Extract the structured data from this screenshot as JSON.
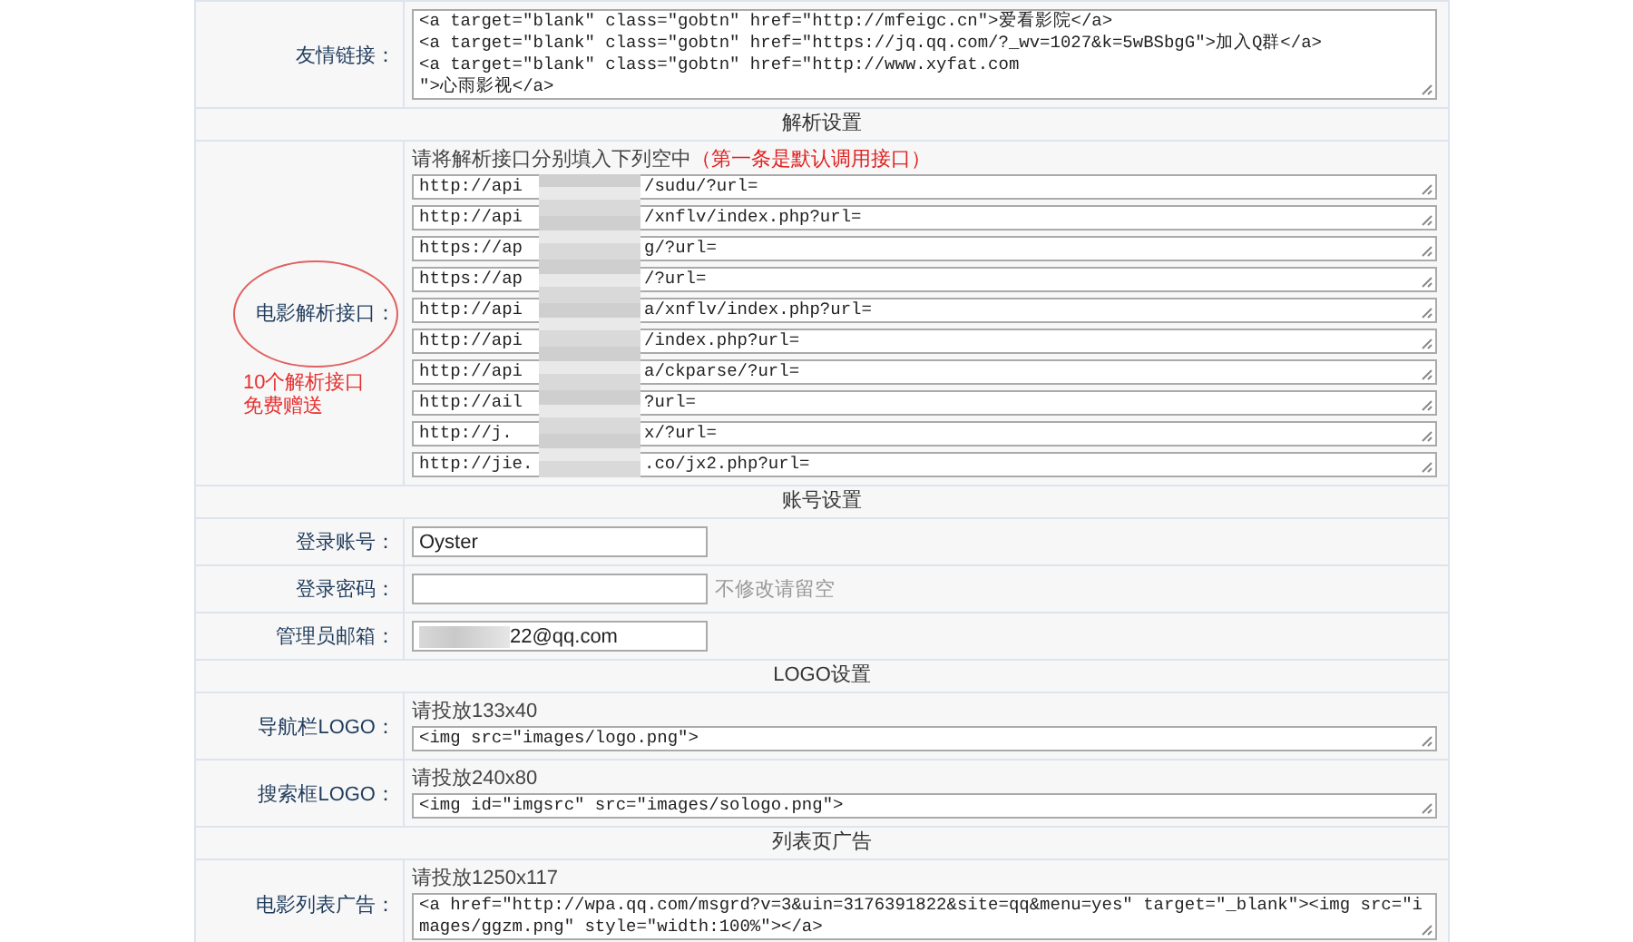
{
  "sections": [
    {
      "kind": "row",
      "label": "友情链接：",
      "code": "<a target=\"blank\" class=\"gobtn\" href=\"http://mfeigc.cn\">爱看影院</a>\n<a target=\"blank\" class=\"gobtn\" href=\"https://jq.qq.com/?_wv=1027&k=5wBSbgG\">加入Q群</a>\n<a target=\"blank\" class=\"gobtn\" href=\"http://www.xyfat.com\n\">心雨影视</a>"
    },
    {
      "kind": "header",
      "title": "解析设置"
    },
    {
      "kind": "apis",
      "label": "电影解析接口：",
      "circled": true,
      "annotation": "10个解析接口免费赠送",
      "hint": "请将解析接口分别填入下列空中",
      "hint_note": "（第一条是默认调用接口）",
      "redacted": true,
      "fields": [
        {
          "start": "http://api",
          "end": "/sudu/?url="
        },
        {
          "start": "http://api",
          "end": "/xnflv/index.php?url="
        },
        {
          "start": "https://ap",
          "end": "g/?url="
        },
        {
          "start": "https://ap",
          "end": "/?url="
        },
        {
          "start": "http://api",
          "end": "a/xnflv/index.php?url="
        },
        {
          "start": "http://api",
          "end": "/index.php?url="
        },
        {
          "start": "http://api",
          "end": "a/ckparse/?url="
        },
        {
          "start": "http://ail",
          "end": "?url="
        },
        {
          "start": "http://j.",
          "end": "x/?url="
        },
        {
          "start": "http://jie.",
          "end": ".co/jx2.php?url="
        }
      ]
    },
    {
      "kind": "header",
      "title": "账号设置"
    },
    {
      "kind": "input",
      "label": "登录账号：",
      "value": "Oyster"
    },
    {
      "kind": "input",
      "label": "登录密码：",
      "note": "不修改请留空"
    },
    {
      "kind": "input",
      "label": "管理员邮箱：",
      "value": "22@qq.com",
      "redacted": true
    },
    {
      "kind": "header",
      "title": "LOGO设置"
    },
    {
      "kind": "row",
      "label": "导航栏LOGO：",
      "hint": "请投放133x40",
      "code": "<img src=\"images/logo.png\">"
    },
    {
      "kind": "row",
      "label": "搜索框LOGO：",
      "hint": "请投放240x80",
      "code": "<img id=\"imgsrc\" src=\"images/sologo.png\">"
    },
    {
      "kind": "header",
      "title": "列表页广告"
    },
    {
      "kind": "row",
      "label": "电影列表广告：",
      "hint": "请投放1250x117",
      "code": "<a href=\"http://wpa.qq.com/msgrd?v=3&uin=3176391822&site=qq&menu=yes\" target=\"_blank\"><img src=\"images/ggzm.png\" style=\"width:100%\"></a>"
    }
  ]
}
